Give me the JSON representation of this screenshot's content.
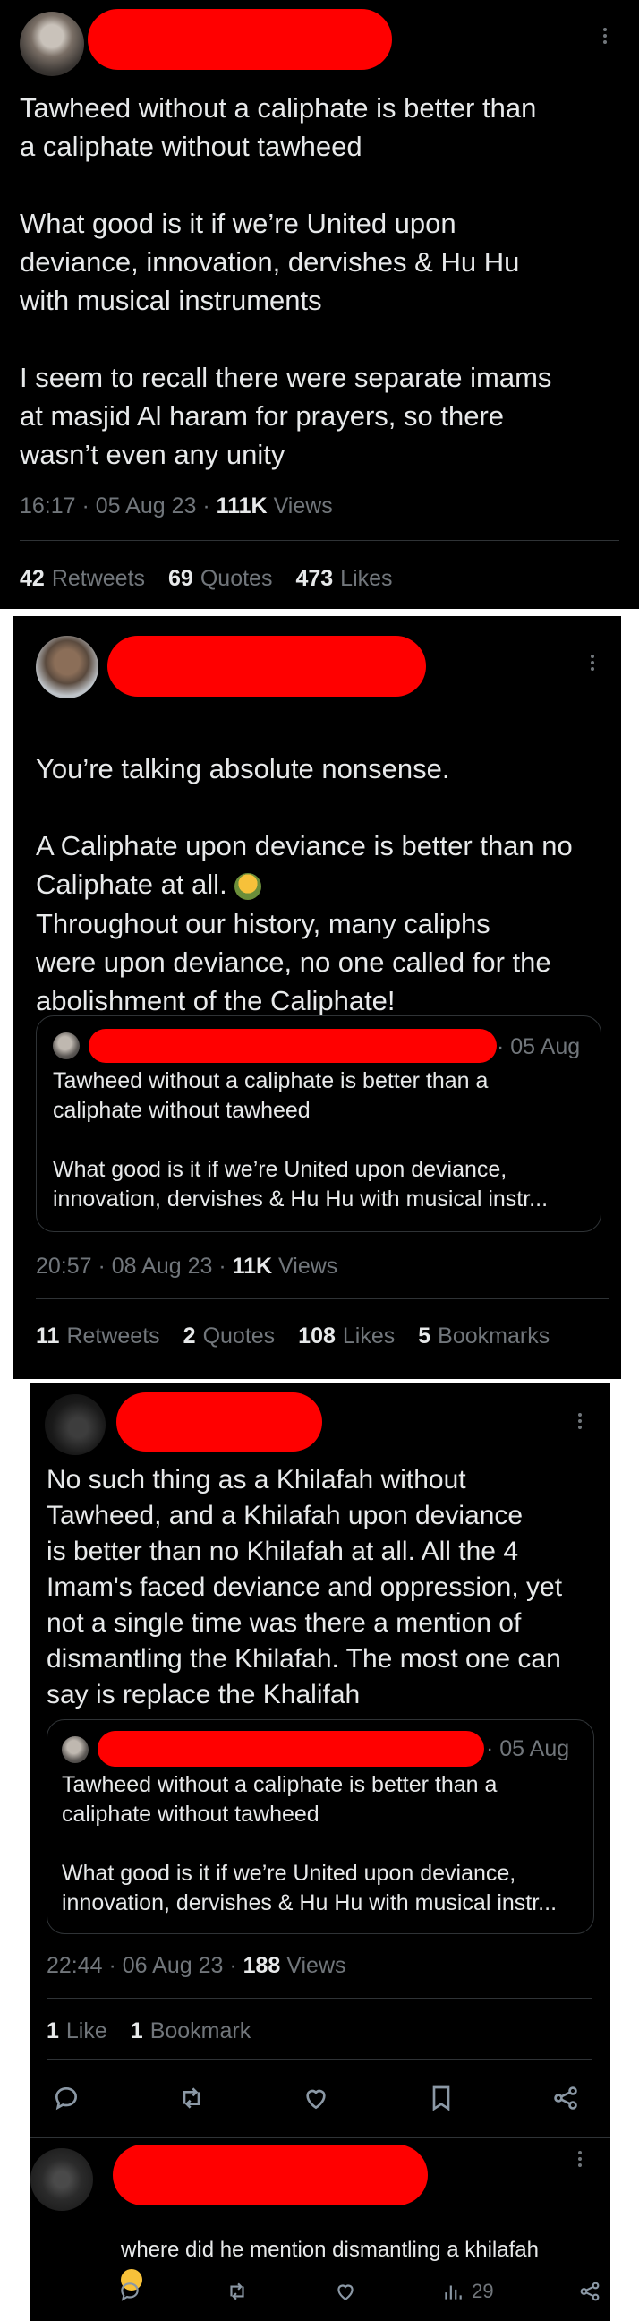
{
  "tweet1": {
    "text": "Tawheed without a caliphate is better than\na caliphate without tawheed\n\nWhat good is it if we’re United upon\ndeviance, innovation, dervishes & Hu Hu\nwith musical instruments\n\nI seem to recall there were separate imams\nat masjid Al haram for prayers, so there\nwasn’t even any unity",
    "time": "16:17 · 05 Aug 23 · ",
    "views_count": "111K",
    "views_label": " Views",
    "retweets_count": "42",
    "retweets_label": "Retweets",
    "quotes_count": "69",
    "quotes_label": "Quotes",
    "likes_count": "473",
    "likes_label": "Likes"
  },
  "tweet2": {
    "text_a": "You’re talking absolute nonsense.\n\nA Caliphate upon deviance is better than no\nCaliphate at all.",
    "text_b": "Throughout our history, many caliphs\nwere upon deviance, no one called for the\nabolishment of the Caliphate!",
    "quote_date": "· 05 Aug",
    "quote_text": "Tawheed without a caliphate is better than a\ncaliphate without tawheed\n\nWhat good is it if we’re United upon deviance,\ninnovation, dervishes & Hu Hu with musical instr...",
    "time": "20:57 · 08 Aug 23 · ",
    "views_count": "11K",
    "views_label": " Views",
    "retweets_count": "11",
    "retweets_label": "Retweets",
    "quotes_count": "2",
    "quotes_label": "Quotes",
    "likes_count": "108",
    "likes_label": "Likes",
    "bookmarks_count": "5",
    "bookmarks_label": "Bookmarks"
  },
  "tweet3": {
    "text": "No such thing as a Khilafah without\nTawheed, and a Khilafah upon deviance\nis better than no Khilafah at all. All the 4\nImam's faced deviance and oppression, yet\nnot a single time was there a mention of\ndismantling the Khilafah. The most one can\nsay is replace the Khalifah",
    "quote_date": "· 05 Aug",
    "quote_text": "Tawheed without a caliphate is better than a\ncaliphate without tawheed\n\nWhat good is it if we’re United upon deviance,\ninnovation, dervishes & Hu Hu with musical instr...",
    "time": "22:44 · 06 Aug 23 · ",
    "views_count": "188",
    "views_label": " Views",
    "likes_count": "1",
    "likes_label": "Like",
    "bookmarks_count": "1",
    "bookmarks_label": "Bookmark"
  },
  "reply": {
    "text": "where did he mention dismantling a khilafah",
    "views": "29"
  },
  "icons": {
    "reply": "reply-icon",
    "retweet": "retweet-icon",
    "like": "like-icon",
    "bookmark": "bookmark-icon",
    "share": "share-icon",
    "views": "views-icon",
    "more": "more-icon"
  },
  "colors": {
    "background": "#000000",
    "text": "#e7e9ea",
    "muted": "#71767b",
    "redaction": "#ff0000",
    "divider": "#2f3336"
  }
}
